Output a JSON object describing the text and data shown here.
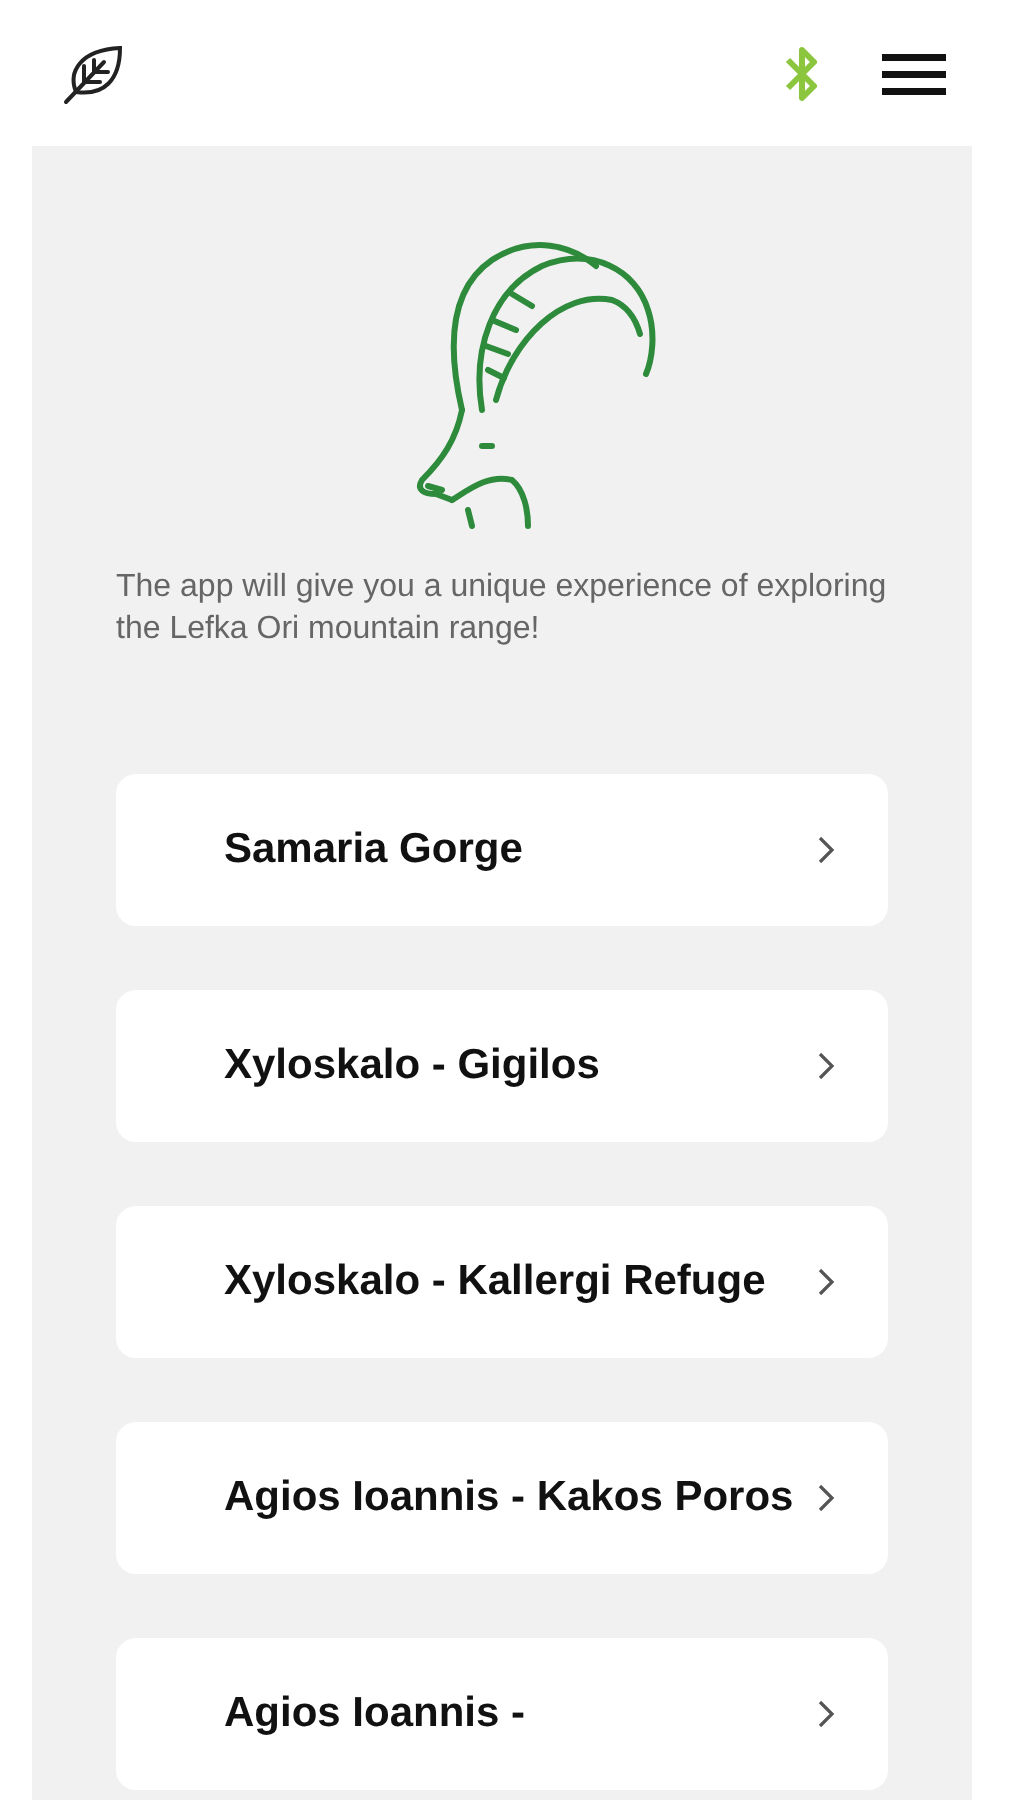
{
  "header": {
    "bluetooth_on": true
  },
  "intro": "The app will give you a unique experience of exploring the Lefka Ori mountain range!",
  "routes": [
    {
      "name": "Samaria Gorge"
    },
    {
      "name": "Xyloskalo - Gigilos"
    },
    {
      "name": "Xyloskalo - Kallergi Refuge"
    },
    {
      "name": "Agios Ioannis - Kakos Poros"
    },
    {
      "name": "Agios Ioannis -"
    }
  ]
}
